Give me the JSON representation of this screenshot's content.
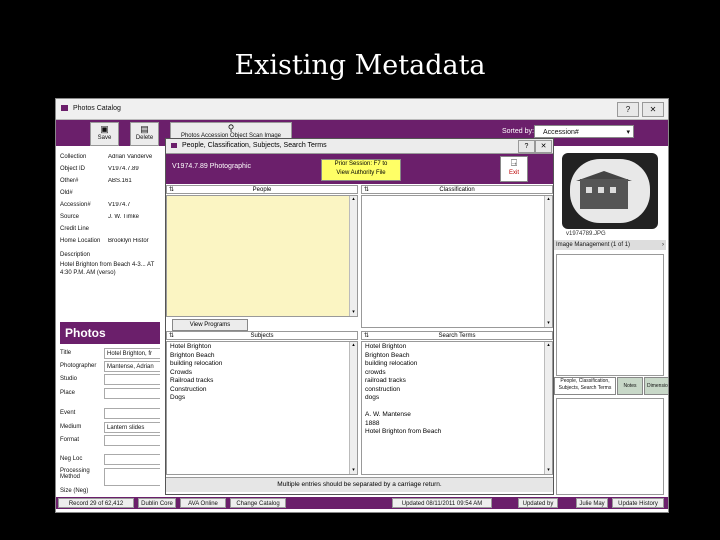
{
  "slide": {
    "title": "Existing Metadata"
  },
  "app": {
    "window_title": "Photos Catalog",
    "help_label": "?",
    "close_label": "✕",
    "toolbar": {
      "save_label": "Save",
      "delete_label": "Delete",
      "wide_label": "Photos Accession Object Scan Image",
      "sort_by_label": "Sorted by:",
      "sort_by_value": "Accession#"
    },
    "fields": [
      {
        "label": "Collection",
        "value": "Adrian Vanderve"
      },
      {
        "label": "Object ID",
        "value": "V1974.7.89"
      },
      {
        "label": "Other#",
        "value": "ABS.161"
      },
      {
        "label": "Old#",
        "value": ""
      },
      {
        "label": "Accession#",
        "value": "V1974.7"
      },
      {
        "label": "Source",
        "value": "J. W. Timke"
      },
      {
        "label": "Credit Line",
        "value": ""
      },
      {
        "label": "Home Location",
        "value": "Brooklyn Histor"
      }
    ],
    "description_label": "Description",
    "description_value": "Hotel Brighton from Beach 4-3... AT 4:30 P.M. AM (verso)",
    "photos_header": "Photos",
    "photo_fields": [
      {
        "label": "Title",
        "value": "Hotel Brighton, fr"
      },
      {
        "label": "Photographer",
        "value": "Mantense, Adrian"
      },
      {
        "label": "Studio",
        "value": ""
      },
      {
        "label": "Place",
        "value": ""
      },
      {
        "label": "Event",
        "value": ""
      },
      {
        "label": "Medium",
        "value": "Lantern slides"
      },
      {
        "label": "Format",
        "value": ""
      },
      {
        "label": "Neg Loc",
        "value": ""
      },
      {
        "label": "Processing Method",
        "value": ""
      },
      {
        "label": "Size (Neg)",
        "value": ""
      }
    ],
    "image": {
      "filename": "v1974789.JPG",
      "management": "Image Management (1 of 1)"
    },
    "right_tabs": [
      "People, Classification, Subjects, Search Terms",
      "Notes",
      "Dimensions"
    ],
    "status": {
      "record": "Record 29 of 62,412",
      "dublin": "Dublin Core",
      "online": "AVA Online",
      "change_catalog": "Change Catalog",
      "updated": "Updated 08/11/2011 09:54 AM",
      "updated_by": "Updated by",
      "user": "Julie May",
      "history": "Update History"
    }
  },
  "dialog": {
    "title": "People, Classification, Subjects, Search Terms",
    "object_label": "V1974.7.89 Photographic",
    "prior_line1": "Prior Session: F7 to",
    "prior_line2": "View Authority File",
    "exit_label": "Exit",
    "people_header": "People",
    "classification_header": "Classification",
    "subjects_header": "Subjects",
    "search_terms_header": "Search Terms",
    "view_programs_label": "View Programs",
    "subjects": [
      "Hotel Brighton",
      "Brighton Beach",
      "building relocation",
      "Crowds",
      "Railroad tracks",
      "Construction",
      "Dogs"
    ],
    "search_terms": [
      "Hotel Brighton",
      "Brighton Beach",
      "building relocation",
      "crowds",
      "railroad tracks",
      "construction",
      "dogs",
      "",
      "A. W. Mantense",
      "1888",
      "Hotel Brighton from Beach"
    ],
    "footnote": "Multiple entries should be separated by a carriage return."
  },
  "colors": {
    "accent": "#6b1f6b",
    "people_bg": "#fbf5c3",
    "prior_bg": "#ffff66"
  }
}
